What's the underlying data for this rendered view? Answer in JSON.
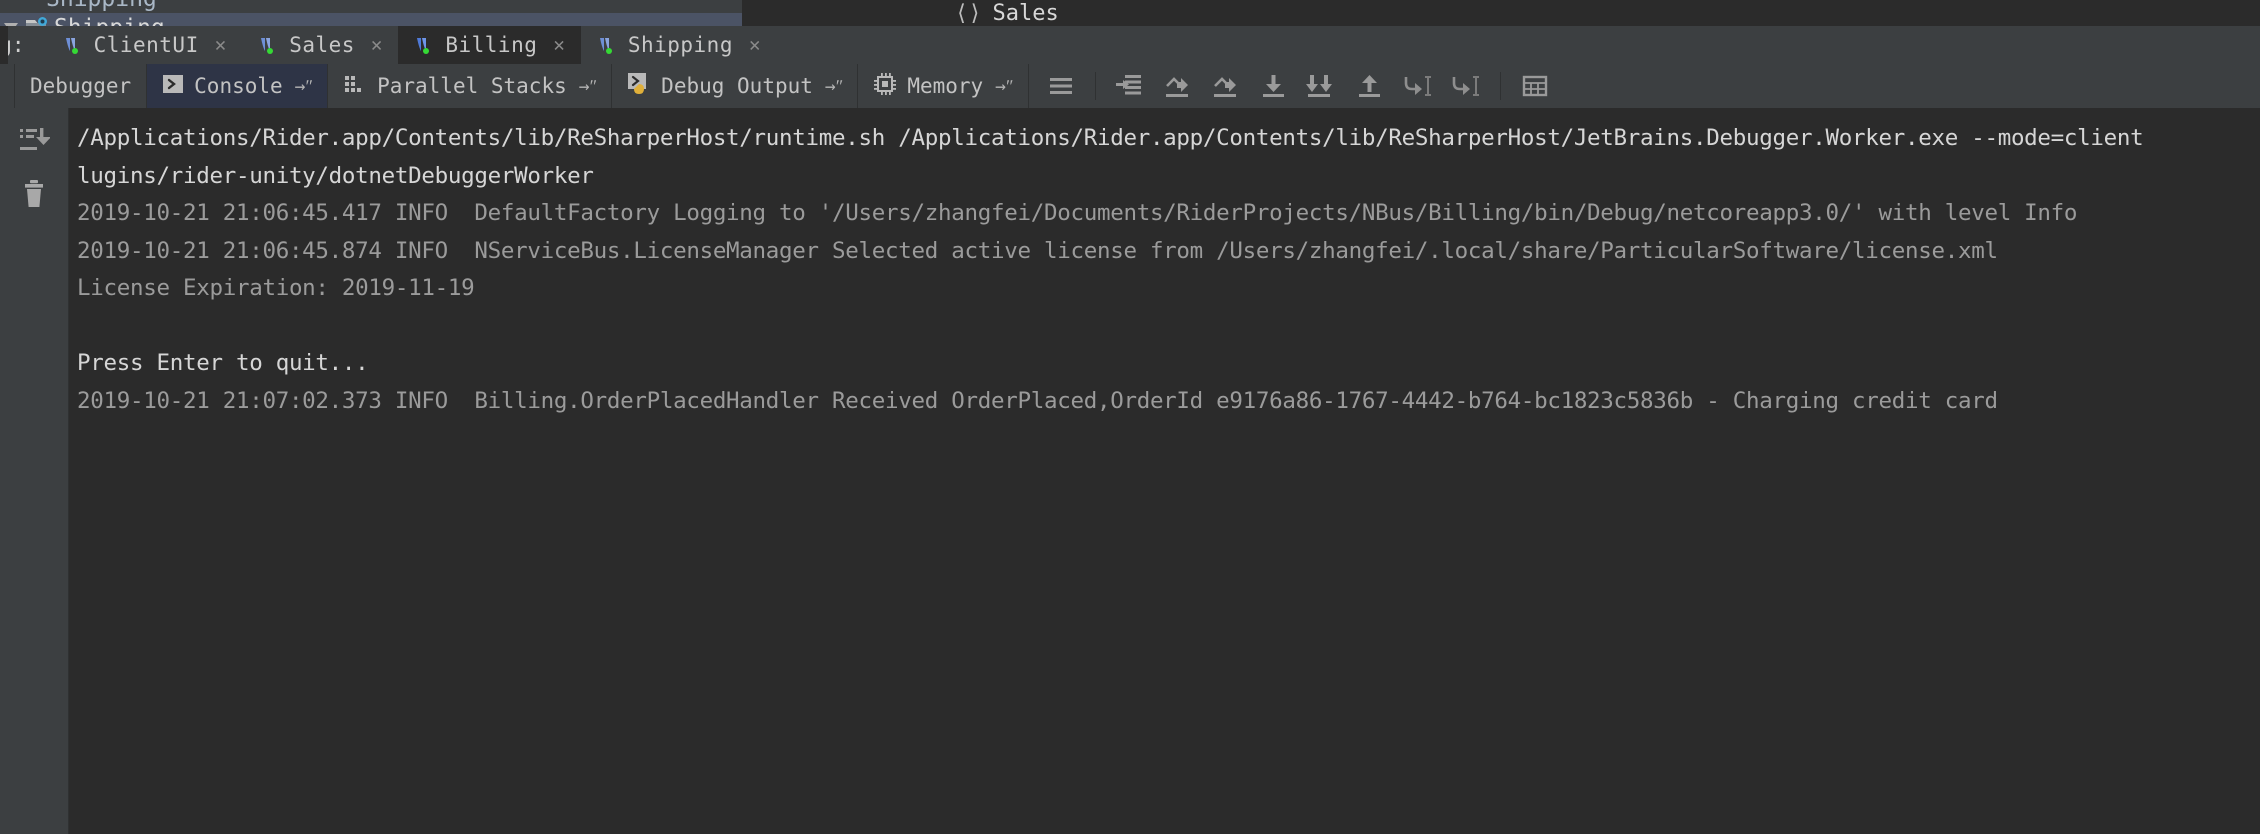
{
  "tree": {
    "partial_row_text": "Shipping",
    "selected_item_label": "Shipping",
    "selected_item_icon": "csharp-class-icon",
    "expand_arrow_icon": "triangle-down-icon"
  },
  "editor_header": {
    "braces_icon": "angle-brackets-icon",
    "title": "Sales"
  },
  "session_tabs": {
    "group_label": "bug:",
    "items": [
      {
        "label": "ClientUI",
        "icon": "nservicebus-icon",
        "running": true,
        "active": false,
        "close_icon": "close-icon"
      },
      {
        "label": "Sales",
        "icon": "nservicebus-icon",
        "running": true,
        "active": false,
        "close_icon": "close-icon"
      },
      {
        "label": "Billing",
        "icon": "nservicebus-icon",
        "running": true,
        "active": true,
        "close_icon": "close-icon"
      },
      {
        "label": "Shipping",
        "icon": "nservicebus-icon",
        "running": true,
        "active": false,
        "close_icon": "close-icon"
      }
    ]
  },
  "debug_toolbar": {
    "tabs": [
      {
        "label": "Debugger",
        "icon": null,
        "has_dropdown": false,
        "active": false
      },
      {
        "label": "Console",
        "icon": "console-icon",
        "has_dropdown": true,
        "active": true,
        "dropdown_glyph": "→ʺ"
      },
      {
        "label": "Parallel Stacks",
        "icon": "parallel-stacks-icon",
        "has_dropdown": true,
        "active": false,
        "dropdown_glyph": "→ʺ"
      },
      {
        "label": "Debug Output",
        "icon": "debug-output-icon",
        "has_dropdown": true,
        "active": false,
        "dropdown_glyph": "→ʺ"
      },
      {
        "label": "Memory",
        "icon": "memory-icon",
        "has_dropdown": true,
        "active": false,
        "dropdown_glyph": "→ʺ"
      }
    ],
    "buttons": [
      {
        "name": "settings-lines-icon",
        "tooltip": "Settings"
      },
      {
        "name": "step-into-smart-icon",
        "tooltip": "Force Step Into"
      },
      {
        "name": "step-over-icon",
        "tooltip": "Step Over"
      },
      {
        "name": "step-over-force-icon",
        "tooltip": "Force Step Over"
      },
      {
        "name": "step-into-icon",
        "tooltip": "Step Into"
      },
      {
        "name": "step-into-force-icon",
        "tooltip": "Force Step Into"
      },
      {
        "name": "step-out-icon",
        "tooltip": "Step Out"
      },
      {
        "name": "run-to-cursor-icon",
        "tooltip": "Run to Cursor"
      },
      {
        "name": "force-run-to-cursor-icon",
        "tooltip": "Force Run to Cursor"
      },
      {
        "name": "evaluate-expression-icon",
        "tooltip": "Evaluate Expression"
      }
    ]
  },
  "console_gutter": {
    "buttons": [
      {
        "name": "scroll-to-end-icon",
        "tooltip": "Scroll to the end"
      },
      {
        "name": "trash-icon",
        "tooltip": "Clear All"
      }
    ]
  },
  "console": {
    "lines": [
      {
        "style": "white",
        "text": "/Applications/Rider.app/Contents/lib/ReSharperHost/runtime.sh /Applications/Rider.app/Contents/lib/ReSharperHost/JetBrains.Debugger.Worker.exe --mode=client"
      },
      {
        "style": "white",
        "text": "lugins/rider-unity/dotnetDebuggerWorker"
      },
      {
        "style": "grey",
        "text": "2019-10-21 21:06:45.417 INFO  DefaultFactory Logging to '/Users/zhangfei/Documents/RiderProjects/NBus/Billing/bin/Debug/netcoreapp3.0/' with level Info"
      },
      {
        "style": "grey",
        "text": "2019-10-21 21:06:45.874 INFO  NServiceBus.LicenseManager Selected active license from /Users/zhangfei/.local/share/ParticularSoftware/license.xml"
      },
      {
        "style": "grey",
        "text": "License Expiration: 2019-11-19"
      },
      {
        "style": "blank",
        "text": " "
      },
      {
        "style": "white",
        "text": "Press Enter to quit..."
      },
      {
        "style": "grey",
        "text": "2019-10-21 21:07:02.373 INFO  Billing.OrderPlacedHandler Received OrderPlaced,OrderId e9176a86-1767-4442-b764-bc1823c5836b - Charging credit card"
      }
    ]
  },
  "colors": {
    "background": "#2b2b2b",
    "panel": "#3c3f41",
    "selection": "#4b5365",
    "active_tab": "#2e3446",
    "text_primary": "#d6d6d6",
    "text_secondary": "#9b9b9b",
    "running_indicator": "#35d935",
    "nsb_blue": "#6e8fd6"
  }
}
